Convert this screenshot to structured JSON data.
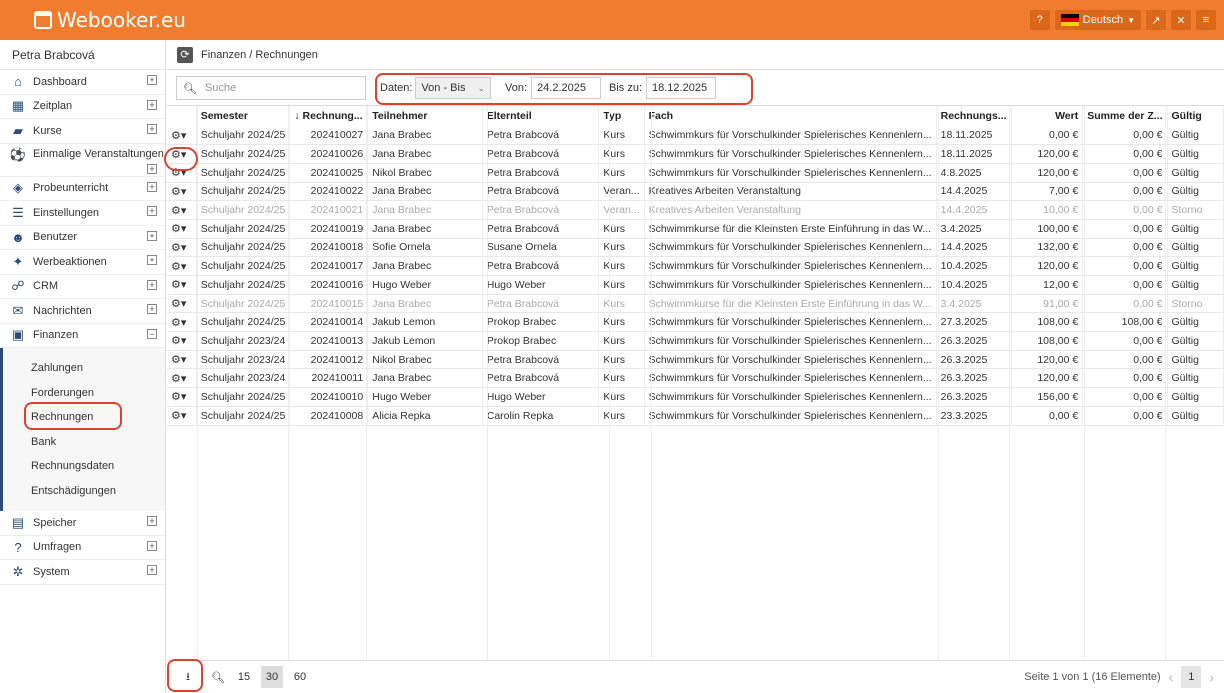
{
  "app": {
    "title": "Webooker.eu"
  },
  "topbar": {
    "language": "Deutsch",
    "help_icon": "question-icon",
    "external_icon": "external-link-icon",
    "close_icon": "close-icon",
    "menu_icon": "hamburger-icon"
  },
  "sidebar": {
    "user": "Petra Brabcová",
    "items": [
      {
        "label": "Dashboard",
        "icon": "home-icon",
        "glyph": "⌂",
        "expander": "+"
      },
      {
        "label": "Zeitplan",
        "icon": "calendar-icon",
        "glyph": "▦",
        "expander": "+"
      },
      {
        "label": "Kurse",
        "icon": "book-icon",
        "glyph": "▰",
        "expander": "+"
      },
      {
        "label": "Einmalige Veranstaltungen",
        "icon": "soccer-ball-icon",
        "glyph": "⚽",
        "expander": "+"
      },
      {
        "label": "Probeunterricht",
        "icon": "eye-slash-icon",
        "glyph": "◈",
        "expander": "+"
      },
      {
        "label": "Einstellungen",
        "icon": "settings-icon",
        "glyph": "☰",
        "expander": "+"
      },
      {
        "label": "Benutzer",
        "icon": "users-icon",
        "glyph": "☻",
        "expander": "+"
      },
      {
        "label": "Werbeaktionen",
        "icon": "gift-icon",
        "glyph": "✦",
        "expander": "+"
      },
      {
        "label": "CRM",
        "icon": "handshake-icon",
        "glyph": "☍",
        "expander": "+"
      },
      {
        "label": "Nachrichten",
        "icon": "envelope-icon",
        "glyph": "✉",
        "expander": "+"
      },
      {
        "label": "Finanzen",
        "icon": "money-icon",
        "glyph": "▣",
        "expander": "−"
      }
    ],
    "finance_sub": [
      "Zahlungen",
      "Forderungen",
      "Rechnungen",
      "Bank",
      "Rechnungsdaten",
      "Entschädigungen"
    ],
    "bottom_items": [
      {
        "label": "Speicher",
        "icon": "database-icon",
        "glyph": "▤",
        "expander": "+"
      },
      {
        "label": "Umfragen",
        "icon": "question-mark-icon",
        "glyph": "?",
        "expander": "+"
      },
      {
        "label": "System",
        "icon": "cogs-icon",
        "glyph": "✲",
        "expander": "+"
      }
    ]
  },
  "breadcrumb": "Finanzen / Rechnungen",
  "filters": {
    "search_placeholder": "Suche",
    "daten_label": "Daten:",
    "daten_value": "Von - Bis",
    "von_label": "Von:",
    "von_value": "24.2.2025",
    "bis_label": "Bis zu:",
    "bis_value": "18.12.2025"
  },
  "table": {
    "headers": [
      "Semester",
      "Rechnung...",
      "Teilnehmer",
      "Elternteil",
      "Typ",
      "Fach",
      "Rechnungs...",
      "Wert",
      "Summe der Z...",
      "Gültig"
    ],
    "rows": [
      [
        "Schuljahr 2024/25",
        "202410027",
        "Jana Brabec",
        "Petra Brabcová",
        "Kurs",
        "Schwimmkurs für Vorschulkinder Spielerisches Kennenlern...",
        "18.11.2025",
        "0,00 €",
        "0,00 €",
        "Gültig"
      ],
      [
        "Schuljahr 2024/25",
        "202410026",
        "Jana Brabec",
        "Petra Brabcová",
        "Kurs",
        "Schwimmkurs für Vorschulkinder Spielerisches Kennenlern...",
        "18.11.2025",
        "120,00 €",
        "0,00 €",
        "Gültig"
      ],
      [
        "Schuljahr 2024/25",
        "202410025",
        "Nikol Brabec",
        "Petra Brabcová",
        "Kurs",
        "Schwimmkurs für Vorschulkinder Spielerisches Kennenlern...",
        "4.8.2025",
        "120,00 €",
        "0,00 €",
        "Gültig"
      ],
      [
        "Schuljahr 2024/25",
        "202410022",
        "Jana Brabec",
        "Petra Brabcová",
        "Veran...",
        "Kreatives Arbeiten Veranstaltung",
        "14.4.2025",
        "7,00 €",
        "0,00 €",
        "Gültig"
      ],
      [
        "Schuljahr 2024/25",
        "202410021",
        "Jana Brabec",
        "Petra Brabcová",
        "Veran...",
        "Kreatives Arbeiten Veranstaltung",
        "14.4.2025",
        "10,00 €",
        "0,00 €",
        "Storno"
      ],
      [
        "Schuljahr 2024/25",
        "202410019",
        "Jana Brabec",
        "Petra Brabcová",
        "Kurs",
        "Schwimmkurse für die Kleinsten Erste Einführung in das W...",
        "3.4.2025",
        "100,00 €",
        "0,00 €",
        "Gültig"
      ],
      [
        "Schuljahr 2024/25",
        "202410018",
        "Sofie Ornela",
        "Susane Ornela",
        "Kurs",
        "Schwimmkurs für Vorschulkinder Spielerisches Kennenlern...",
        "14.4.2025",
        "132,00 €",
        "0,00 €",
        "Gültig"
      ],
      [
        "Schuljahr 2024/25",
        "202410017",
        "Jana Brabec",
        "Petra Brabcová",
        "Kurs",
        "Schwimmkurs für Vorschulkinder Spielerisches Kennenlern...",
        "10.4.2025",
        "120,00 €",
        "0,00 €",
        "Gültig"
      ],
      [
        "Schuljahr 2024/25",
        "202410016",
        "Hugo Weber",
        "Hugo Weber",
        "Kurs",
        "Schwimmkurs für Vorschulkinder Spielerisches Kennenlern...",
        "10.4.2025",
        "12,00 €",
        "0,00 €",
        "Gültig"
      ],
      [
        "Schuljahr 2024/25",
        "202410015",
        "Jana Brabec",
        "Petra Brabcová",
        "Kurs",
        "Schwimmkurse für die Kleinsten Erste Einführung in das W...",
        "3.4.2025",
        "91,00 €",
        "0,00 €",
        "Storno"
      ],
      [
        "Schuljahr 2024/25",
        "202410014",
        "Jakub Lemon",
        "Prokop Brabec",
        "Kurs",
        "Schwimmkurs für Vorschulkinder Spielerisches Kennenlern...",
        "27.3.2025",
        "108,00 €",
        "108,00 €",
        "Gültig"
      ],
      [
        "Schuljahr 2023/24",
        "202410013",
        "Jakub Lemon",
        "Prokop Brabec",
        "Kurs",
        "Schwimmkurs für Vorschulkinder Spielerisches Kennenlern...",
        "26.3.2025",
        "108,00 €",
        "0,00 €",
        "Gültig"
      ],
      [
        "Schuljahr 2023/24",
        "202410012",
        "Nikol Brabec",
        "Petra Brabcová",
        "Kurs",
        "Schwimmkurs für Vorschulkinder Spielerisches Kennenlern...",
        "26.3.2025",
        "120,00 €",
        "0,00 €",
        "Gültig"
      ],
      [
        "Schuljahr 2023/24",
        "202410011",
        "Jana Brabec",
        "Petra Brabcová",
        "Kurs",
        "Schwimmkurs für Vorschulkinder Spielerisches Kennenlern...",
        "26.3.2025",
        "120,00 €",
        "0,00 €",
        "Gültig"
      ],
      [
        "Schuljahr 2024/25",
        "202410010",
        "Hugo Weber",
        "Hugo Weber",
        "Kurs",
        "Schwimmkurs für Vorschulkinder Spielerisches Kennenlern...",
        "26.3.2025",
        "156,00 €",
        "0,00 €",
        "Gültig"
      ],
      [
        "Schuljahr 2024/25",
        "202410008",
        "Alicia Repka",
        "Carolin Repka",
        "Kurs",
        "Schwimmkurs für Vorschulkinder Spielerisches Kennenlern...",
        "23.3.2025",
        "0,00 €",
        "0,00 €",
        "Gültig"
      ]
    ]
  },
  "footer": {
    "page_sizes": [
      "15",
      "30",
      "60"
    ],
    "active_page_size": "30",
    "page_info": "Seite 1 von 1 (16 Elemente)",
    "current_page": "1"
  },
  "colors": {
    "topbar": "#f07c2e",
    "accent_dark": "#2a4d78",
    "annotation_red": "#d8442e"
  }
}
